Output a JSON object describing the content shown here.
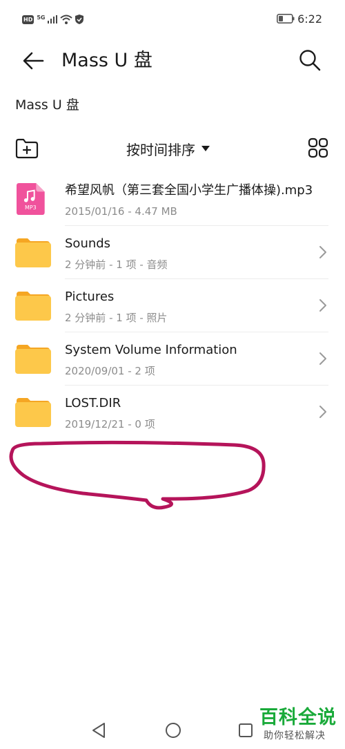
{
  "status_bar": {
    "hd": "HD",
    "signal_type": "5G",
    "time": "6:22"
  },
  "header": {
    "title": "Mass U 盘"
  },
  "breadcrumb": "Mass U 盘",
  "toolbar": {
    "sort_label": "按时间排序"
  },
  "files": [
    {
      "name": "希望风帆（第三套全国小学生广播体操).mp3",
      "meta": "2015/01/16 - 4.47 MB",
      "kind": "mp3",
      "icon_label": "MP3"
    },
    {
      "name": "Sounds",
      "meta": "2 分钟前 - 1 项 - 音频",
      "kind": "folder"
    },
    {
      "name": "Pictures",
      "meta": "2 分钟前 - 1 项 - 照片",
      "kind": "folder"
    },
    {
      "name": "System Volume Information",
      "meta": "2020/09/01 - 2 项",
      "kind": "folder"
    },
    {
      "name": "LOST.DIR",
      "meta": "2019/12/21 - 0 项",
      "kind": "folder"
    }
  ],
  "watermark": {
    "title": "百科全说",
    "subtitle": "助你轻松解决"
  },
  "colors": {
    "folder": "#FDC84A",
    "folder_tab": "#F5A623",
    "mp3_icon": "#F0529C",
    "annotation": "#B5145A",
    "watermark": "#1AAA3A"
  }
}
